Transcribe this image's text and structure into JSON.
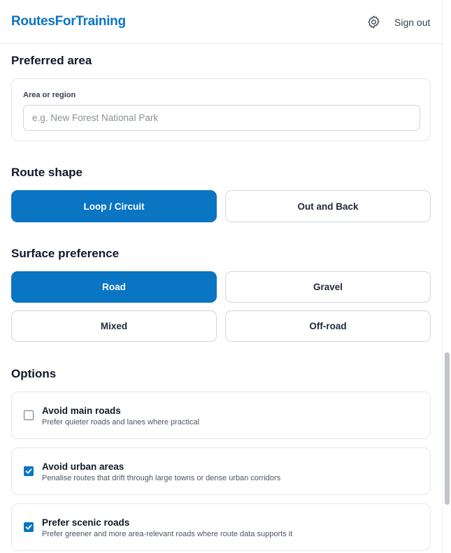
{
  "header": {
    "brand": "RoutesForTraining",
    "settings_icon": "gear-icon",
    "sign_out": "Sign out"
  },
  "preferred_area": {
    "title": "Preferred area",
    "field_label": "Area or region",
    "placeholder": "e.g. New Forest National Park",
    "value": ""
  },
  "route_shape": {
    "title": "Route shape",
    "options": [
      {
        "label": "Loop / Circuit",
        "selected": true
      },
      {
        "label": "Out and Back",
        "selected": false
      }
    ]
  },
  "surface": {
    "title": "Surface preference",
    "options": [
      {
        "label": "Road",
        "selected": true
      },
      {
        "label": "Gravel",
        "selected": false
      },
      {
        "label": "Mixed",
        "selected": false
      },
      {
        "label": "Off-road",
        "selected": false
      }
    ]
  },
  "options": {
    "title": "Options",
    "items": [
      {
        "title": "Avoid main roads",
        "description": "Prefer quieter roads and lanes where practical",
        "checked": false
      },
      {
        "title": "Avoid urban areas",
        "description": "Penalise routes that drift through large towns or dense urban corridors",
        "checked": true
      },
      {
        "title": "Prefer scenic roads",
        "description": "Prefer greener and more area-relevant roads where route data supports it",
        "checked": true
      }
    ]
  },
  "colors": {
    "accent": "#0a75c2",
    "border": "#e5e7eb",
    "text": "#111827"
  }
}
